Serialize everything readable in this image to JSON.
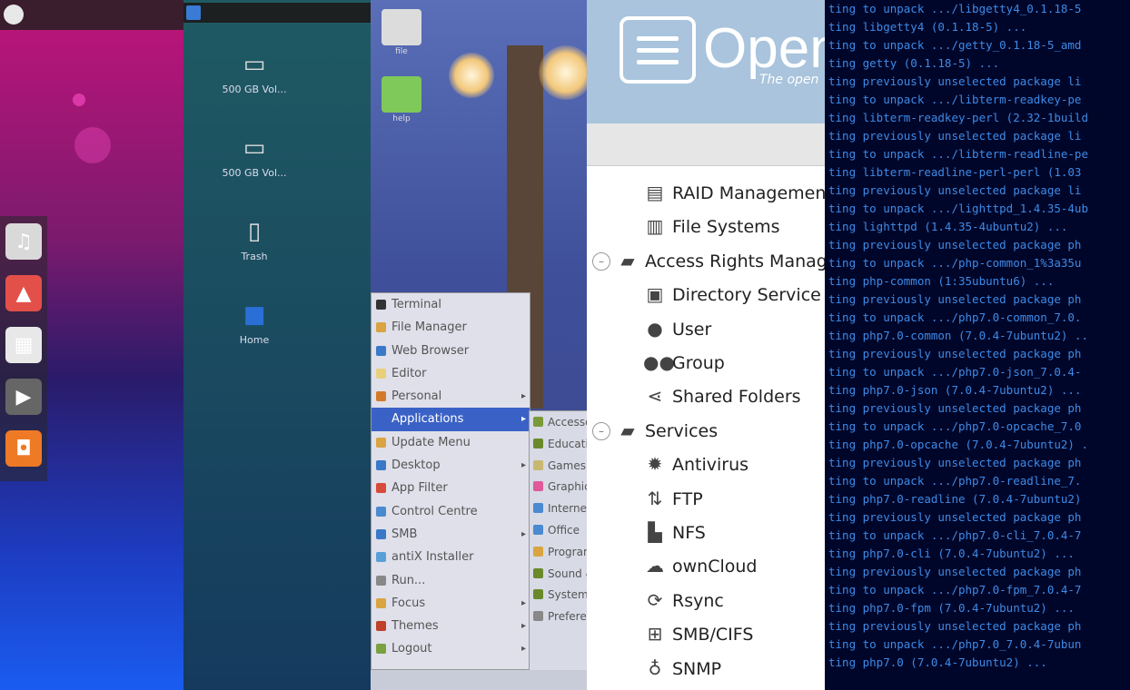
{
  "ubuntu": {
    "launcher": [
      {
        "icon": "music-player-icon",
        "color": "#d9d9d9"
      },
      {
        "icon": "image-viewer-icon",
        "color": "#e3504a"
      },
      {
        "icon": "calendar-icon",
        "color": "#e8e8e8"
      },
      {
        "icon": "video-player-icon",
        "color": "#666666"
      },
      {
        "icon": "ubuntu-software-icon",
        "color": "#ee7a25"
      }
    ]
  },
  "desktop2": {
    "icons": [
      {
        "label": "500 GB Vol...",
        "icon": "drive-icon"
      },
      {
        "label": "500 GB Vol...",
        "icon": "drive-icon"
      },
      {
        "label": "Trash",
        "icon": "trash-icon"
      },
      {
        "label": "Home",
        "icon": "home-folder-icon"
      }
    ]
  },
  "puppy": {
    "desktop_icons": [
      {
        "label": "file",
        "color": "#dcdcdc"
      },
      {
        "label": "help",
        "color": "#7ec95a"
      }
    ],
    "menu": [
      {
        "label": "Terminal",
        "color": "#333333",
        "submenu": false
      },
      {
        "label": "File Manager",
        "color": "#d9a441",
        "submenu": false
      },
      {
        "label": "Web Browser",
        "color": "#3a78c8",
        "submenu": false
      },
      {
        "label": "Editor",
        "color": "#e8d07a",
        "submenu": false
      },
      {
        "label": "Personal",
        "color": "#d27a2a",
        "submenu": true
      },
      {
        "label": "Applications",
        "color": "#3a62c6",
        "submenu": true,
        "selected": true
      },
      {
        "label": "Update Menu",
        "color": "#d9a441",
        "submenu": false
      },
      {
        "label": "Desktop",
        "color": "#3a78c8",
        "submenu": true
      },
      {
        "label": "App Filter",
        "color": "#d84a3a",
        "submenu": false
      },
      {
        "label": "Control Centre",
        "color": "#4a8ad0",
        "submenu": false
      },
      {
        "label": "SMB",
        "color": "#3a78c8",
        "submenu": true
      },
      {
        "label": "antiX Installer",
        "color": "#5aa0d8",
        "submenu": false
      },
      {
        "label": "Run...",
        "color": "#888888",
        "submenu": false
      },
      {
        "label": "Focus",
        "color": "#d9a441",
        "submenu": true
      },
      {
        "label": "Themes",
        "color": "#c0402a",
        "submenu": true
      },
      {
        "label": "Logout",
        "color": "#7aa040",
        "submenu": true
      }
    ],
    "submenu": [
      {
        "label": "Accessories",
        "color": "#7a9a3a"
      },
      {
        "label": "Education",
        "color": "#6a8a2a"
      },
      {
        "label": "Games",
        "color": "#c8b870"
      },
      {
        "label": "Graphics",
        "color": "#e05a9a"
      },
      {
        "label": "Internet",
        "color": "#4a8ad0"
      },
      {
        "label": "Office",
        "color": "#4a8ad0"
      },
      {
        "label": "Programming",
        "color": "#d9a441"
      },
      {
        "label": "Sound & Video",
        "color": "#6a8a2a"
      },
      {
        "label": "System",
        "color": "#6a8a2a"
      },
      {
        "label": "Preferences",
        "color": "#888888"
      }
    ]
  },
  "omv": {
    "brand": "Open",
    "tagline": "The open",
    "tree": [
      {
        "label": "RAID Management",
        "icon": "raid-icon",
        "level": "leaf"
      },
      {
        "label": "File Systems",
        "icon": "filesystem-icon",
        "level": "leaf"
      },
      {
        "label": "Access Rights Management",
        "icon": "folder-icon",
        "level": "group"
      },
      {
        "label": "Directory Service",
        "icon": "directory-service-icon",
        "level": "leaf"
      },
      {
        "label": "User",
        "icon": "user-icon",
        "level": "leaf"
      },
      {
        "label": "Group",
        "icon": "group-icon",
        "level": "leaf"
      },
      {
        "label": "Shared Folders",
        "icon": "share-icon",
        "level": "leaf"
      },
      {
        "label": "Services",
        "icon": "folder-icon",
        "level": "group"
      },
      {
        "label": "Antivirus",
        "icon": "antivirus-icon",
        "level": "leaf"
      },
      {
        "label": "FTP",
        "icon": "ftp-icon",
        "level": "leaf"
      },
      {
        "label": "NFS",
        "icon": "nfs-icon",
        "level": "leaf"
      },
      {
        "label": "ownCloud",
        "icon": "cloud-icon",
        "level": "leaf"
      },
      {
        "label": "Rsync",
        "icon": "rsync-icon",
        "level": "leaf"
      },
      {
        "label": "SMB/CIFS",
        "icon": "windows-icon",
        "level": "leaf"
      },
      {
        "label": "SNMP",
        "icon": "snmp-icon",
        "level": "leaf"
      }
    ]
  },
  "terminal": {
    "lines": [
      "ting to unpack .../libgetty4_0.1.18-5",
      "ting libgetty4 (0.1.18-5) ...",
      "ting to unpack .../getty_0.1.18-5_amd",
      "ting getty (0.1.18-5) ...",
      "ting previously unselected package li",
      "ting to unpack .../libterm-readkey-pe",
      "ting libterm-readkey-perl (2.32-1build",
      "ting previously unselected package li",
      "ting to unpack .../libterm-readline-pe",
      "ting libterm-readline-perl-perl (1.03",
      "ting previously unselected package li",
      "ting to unpack .../lighttpd_1.4.35-4ub",
      "ting lighttpd (1.4.35-4ubuntu2) ...",
      "ting previously unselected package ph",
      "ting to unpack .../php-common_1%3a35u",
      "ting php-common (1:35ubuntu6) ...",
      "ting previously unselected package ph",
      "ting to unpack .../php7.0-common_7.0.",
      "ting php7.0-common (7.0.4-7ubuntu2) ..",
      "ting previously unselected package ph",
      "ting to unpack .../php7.0-json_7.0.4-",
      "ting php7.0-json (7.0.4-7ubuntu2) ...",
      "ting previously unselected package ph",
      "ting to unpack .../php7.0-opcache_7.0",
      "ting php7.0-opcache (7.0.4-7ubuntu2) .",
      "ting previously unselected package ph",
      "ting to unpack .../php7.0-readline_7.",
      "ting php7.0-readline (7.0.4-7ubuntu2)",
      "ting previously unselected package ph",
      "ting to unpack .../php7.0-cli_7.0.4-7",
      "ting php7.0-cli (7.0.4-7ubuntu2) ...",
      "ting previously unselected package ph",
      "ting to unpack .../php7.0-fpm_7.0.4-7",
      "ting php7.0-fpm (7.0.4-7ubuntu2) ...",
      "ting previously unselected package ph",
      "ting to unpack .../php7.0_7.0.4-7ubun",
      "ting php7.0 (7.0.4-7ubuntu2) ..."
    ]
  }
}
